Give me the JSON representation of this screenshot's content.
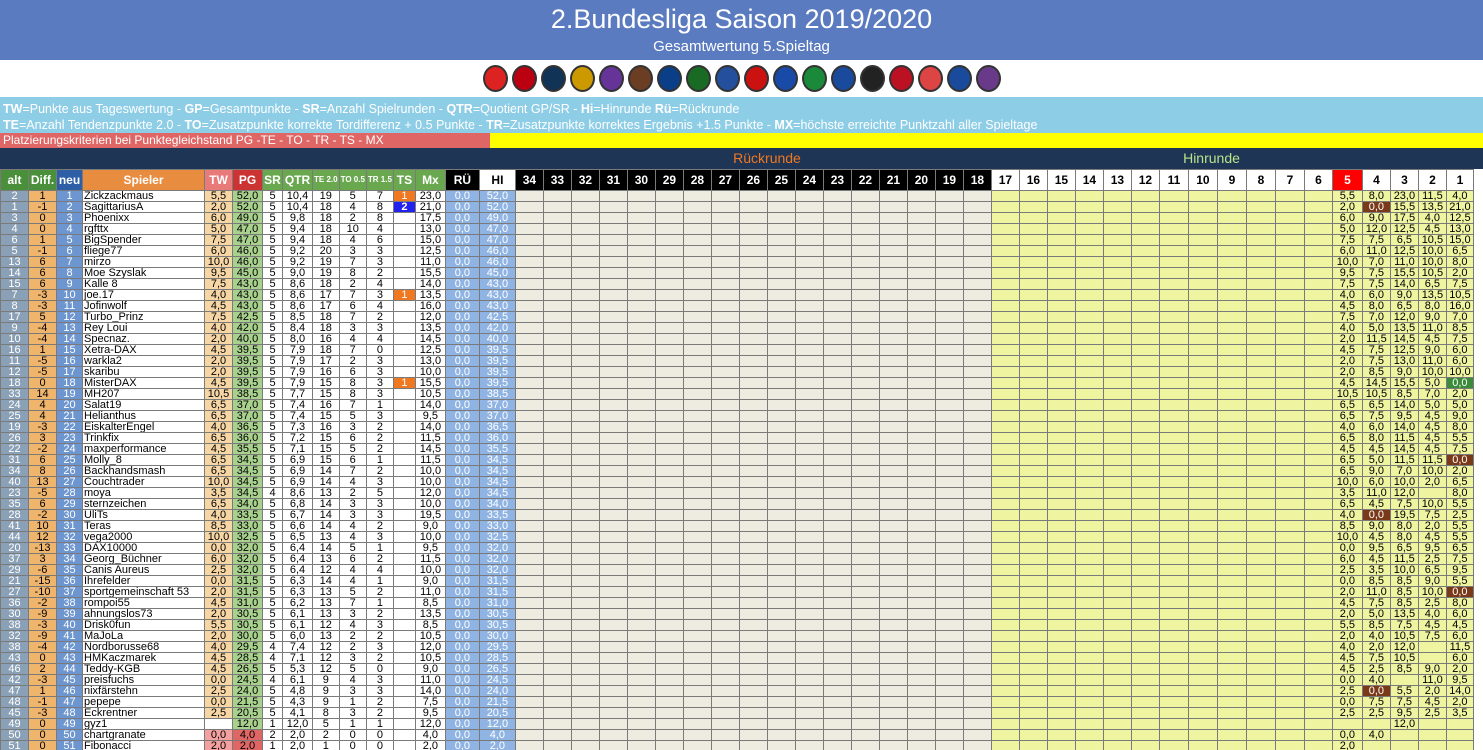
{
  "header": {
    "title": "2.Bundesliga Saison 2019/2020",
    "subtitle": "Gesamtwertung 5.Spieltag"
  },
  "logos": [
    {
      "name": "heidenheim-logo",
      "color": "#d22"
    },
    {
      "name": "nuernberg-logo",
      "color": "#b01"
    },
    {
      "name": "bielefeld-logo",
      "color": "#135"
    },
    {
      "name": "dresden-logo",
      "color": "#c90"
    },
    {
      "name": "aue-logo",
      "color": "#639"
    },
    {
      "name": "stpauli-logo",
      "color": "#6b3d22"
    },
    {
      "name": "hsv-logo",
      "color": "#0a3e87"
    },
    {
      "name": "hannover-logo",
      "color": "#196b24"
    },
    {
      "name": "kiel-logo",
      "color": "#234f9c"
    },
    {
      "name": "regensburg-logo",
      "color": "#c11"
    },
    {
      "name": "karlsruhe-logo",
      "color": "#1a4aa8"
    },
    {
      "name": "fuerth-logo",
      "color": "#1a8a3a"
    },
    {
      "name": "darmstadt-logo",
      "color": "#1a4a9c"
    },
    {
      "name": "sandhausen-logo",
      "color": "#222"
    },
    {
      "name": "wiesbaden-logo",
      "color": "#b12"
    },
    {
      "name": "stuttgart-logo",
      "color": "#d44"
    },
    {
      "name": "bochum-logo",
      "color": "#1a4a9c"
    },
    {
      "name": "osnabrueck-logo",
      "color": "#6a3a8a"
    }
  ],
  "legend": {
    "line1": [
      [
        "TW",
        "=Punkte aus Tageswertung - "
      ],
      [
        "GP",
        "=Gesamtpunkte - "
      ],
      [
        "SR",
        "=Anzahl Spielrunden - "
      ],
      [
        "QTR",
        "=Quotient GP/SR - "
      ],
      [
        "Hi",
        "=Hinrunde "
      ],
      [
        "Rü",
        "=Rückrunde"
      ]
    ],
    "line2": [
      [
        "TE",
        "=Anzahl Tendenzpunkte 2.0 - "
      ],
      [
        "TO",
        "=Zusatzpunkte korrekte Tordifferenz + 0.5 Punkte - "
      ],
      [
        "TR",
        "=Zusatzpunkte korrektes Ergebnis +1.5 Punkte - "
      ],
      [
        "MX",
        "=höchste erreichte Punktzahl aller Spieltage"
      ]
    ]
  },
  "criteria": "Platzierungskriterien bei Punktegleichstand  PG  -TE - TO - TR - TS - MX",
  "groups": {
    "rueckrunde": "Rückrunde",
    "hinrunde": "Hinrunde"
  },
  "columns": {
    "alt": "alt",
    "diff": "Diff.",
    "neu": "neu",
    "spieler": "Spieler",
    "tw": "TW",
    "pg": "PG",
    "sr": "SR",
    "qtr": "QTR",
    "te": "TE 2.0",
    "to": "TO 0.5",
    "tr": "TR 1.5",
    "ts": "TS",
    "mx": "Mx",
    "ru": "RÜ",
    "hi": "HI"
  },
  "rueck_days": [
    "34",
    "33",
    "32",
    "31",
    "30",
    "29",
    "28",
    "27",
    "26",
    "25",
    "24",
    "23",
    "22",
    "21",
    "20",
    "19",
    "18"
  ],
  "hin_days": [
    "17",
    "16",
    "15",
    "14",
    "13",
    "12",
    "11",
    "10",
    "9",
    "8",
    "7",
    "6",
    "5",
    "4",
    "3",
    "2",
    "1"
  ],
  "rows": [
    [
      "2",
      "1",
      "1",
      "Zickzackmaus",
      "5,5",
      "52,0",
      "5",
      "10,4",
      "19",
      "5",
      "7",
      "1",
      "23,0",
      "0,0",
      "52,0",
      "5,5",
      "8,0",
      "23,0",
      "11,5",
      "4,0"
    ],
    [
      "1",
      "-1",
      "2",
      "SagittariusA",
      "2,0",
      "52,0",
      "5",
      "10,4",
      "18",
      "4",
      "8",
      "2",
      "21,0",
      "0,0",
      "52,0",
      "2,0",
      "0,0",
      "15,5",
      "13,5",
      "21,0"
    ],
    [
      "3",
      "0",
      "3",
      "Phoenixx",
      "6,0",
      "49,0",
      "5",
      "9,8",
      "18",
      "2",
      "8",
      "",
      "17,5",
      "0,0",
      "49,0",
      "6,0",
      "9,0",
      "17,5",
      "4,0",
      "12,5"
    ],
    [
      "4",
      "0",
      "4",
      "rgfttx",
      "5,0",
      "47,0",
      "5",
      "9,4",
      "18",
      "10",
      "4",
      "",
      "13,0",
      "0,0",
      "47,0",
      "5,0",
      "12,0",
      "12,5",
      "4,5",
      "13,0"
    ],
    [
      "6",
      "1",
      "5",
      "BigSpender",
      "7,5",
      "47,0",
      "5",
      "9,4",
      "18",
      "4",
      "6",
      "",
      "15,0",
      "0,0",
      "47,0",
      "7,5",
      "7,5",
      "6,5",
      "10,5",
      "15,0"
    ],
    [
      "5",
      "-1",
      "6",
      "fliege77",
      "6,0",
      "46,0",
      "5",
      "9,2",
      "20",
      "3",
      "3",
      "",
      "12,5",
      "0,0",
      "46,0",
      "6,0",
      "11,0",
      "12,5",
      "10,0",
      "6,5"
    ],
    [
      "13",
      "6",
      "7",
      "mirzo",
      "10,0",
      "46,0",
      "5",
      "9,2",
      "19",
      "7",
      "3",
      "",
      "11,0",
      "0,0",
      "46,0",
      "10,0",
      "7,0",
      "11,0",
      "10,0",
      "8,0"
    ],
    [
      "14",
      "6",
      "8",
      "Moe Szyslak",
      "9,5",
      "45,0",
      "5",
      "9,0",
      "19",
      "8",
      "2",
      "",
      "15,5",
      "0,0",
      "45,0",
      "9,5",
      "7,5",
      "15,5",
      "10,5",
      "2,0"
    ],
    [
      "15",
      "6",
      "9",
      "Kalle 8",
      "7,5",
      "43,0",
      "5",
      "8,6",
      "18",
      "2",
      "4",
      "",
      "14,0",
      "0,0",
      "43,0",
      "7,5",
      "7,5",
      "14,0",
      "6,5",
      "7,5"
    ],
    [
      "7",
      "-3",
      "10",
      "joe.17",
      "4,0",
      "43,0",
      "5",
      "8,6",
      "17",
      "7",
      "3",
      "1",
      "13,5",
      "0,0",
      "43,0",
      "4,0",
      "6,0",
      "9,0",
      "13,5",
      "10,5"
    ],
    [
      "8",
      "-3",
      "11",
      "Jofinwolf",
      "4,5",
      "43,0",
      "5",
      "8,6",
      "17",
      "6",
      "4",
      "",
      "16,0",
      "0,0",
      "43,0",
      "4,5",
      "8,0",
      "6,5",
      "8,0",
      "16,0"
    ],
    [
      "17",
      "5",
      "12",
      "Turbo_Prinz",
      "7,5",
      "42,5",
      "5",
      "8,5",
      "18",
      "7",
      "2",
      "",
      "12,0",
      "0,0",
      "42,5",
      "7,5",
      "7,0",
      "12,0",
      "9,0",
      "7,0"
    ],
    [
      "9",
      "-4",
      "13",
      "Rey Loui",
      "4,0",
      "42,0",
      "5",
      "8,4",
      "18",
      "3",
      "3",
      "",
      "13,5",
      "0,0",
      "42,0",
      "4,0",
      "5,0",
      "13,5",
      "11,0",
      "8,5"
    ],
    [
      "10",
      "-4",
      "14",
      "Specnaz.",
      "2,0",
      "40,0",
      "5",
      "8,0",
      "16",
      "4",
      "4",
      "",
      "14,5",
      "0,0",
      "40,0",
      "2,0",
      "11,5",
      "14,5",
      "4,5",
      "7,5"
    ],
    [
      "16",
      "1",
      "15",
      "Xetra-DAX",
      "4,5",
      "39,5",
      "5",
      "7,9",
      "18",
      "7",
      "0",
      "",
      "12,5",
      "0,0",
      "39,5",
      "4,5",
      "7,5",
      "12,5",
      "9,0",
      "6,0"
    ],
    [
      "11",
      "-5",
      "16",
      "warkla2",
      "2,0",
      "39,5",
      "5",
      "7,9",
      "17",
      "2",
      "3",
      "",
      "13,0",
      "0,0",
      "39,5",
      "2,0",
      "7,5",
      "13,0",
      "11,0",
      "6,0"
    ],
    [
      "12",
      "-5",
      "17",
      "skaribu",
      "2,0",
      "39,5",
      "5",
      "7,9",
      "16",
      "6",
      "3",
      "",
      "10,0",
      "0,0",
      "39,5",
      "2,0",
      "8,5",
      "9,0",
      "10,0",
      "10,0"
    ],
    [
      "18",
      "0",
      "18",
      "MisterDAX",
      "4,5",
      "39,5",
      "5",
      "7,9",
      "15",
      "8",
      "3",
      "1",
      "15,5",
      "0,0",
      "39,5",
      "4,5",
      "14,5",
      "15,5",
      "5,0",
      "0,0"
    ],
    [
      "33",
      "14",
      "19",
      "MH207",
      "10,5",
      "38,5",
      "5",
      "7,7",
      "15",
      "8",
      "3",
      "",
      "10,5",
      "0,0",
      "38,5",
      "10,5",
      "10,5",
      "8,5",
      "7,0",
      "2,0"
    ],
    [
      "24",
      "4",
      "20",
      "Salat19",
      "6,5",
      "37,0",
      "5",
      "7,4",
      "16",
      "7",
      "1",
      "",
      "14,0",
      "0,0",
      "37,0",
      "6,5",
      "6,5",
      "14,0",
      "5,0",
      "5,0"
    ],
    [
      "25",
      "4",
      "21",
      "Helianthus",
      "6,5",
      "37,0",
      "5",
      "7,4",
      "15",
      "5",
      "3",
      "",
      "9,5",
      "0,0",
      "37,0",
      "6,5",
      "7,5",
      "9,5",
      "4,5",
      "9,0"
    ],
    [
      "19",
      "-3",
      "22",
      "EiskalterEngel",
      "4,0",
      "36,5",
      "5",
      "7,3",
      "16",
      "3",
      "2",
      "",
      "14,0",
      "0,0",
      "36,5",
      "4,0",
      "6,0",
      "14,0",
      "4,5",
      "8,0"
    ],
    [
      "26",
      "3",
      "23",
      "Trinkfix",
      "6,5",
      "36,0",
      "5",
      "7,2",
      "15",
      "6",
      "2",
      "",
      "11,5",
      "0,0",
      "36,0",
      "6,5",
      "8,0",
      "11,5",
      "4,5",
      "5,5"
    ],
    [
      "22",
      "-2",
      "24",
      "maxperformance",
      "4,5",
      "35,5",
      "5",
      "7,1",
      "15",
      "5",
      "2",
      "",
      "14,5",
      "0,0",
      "35,5",
      "4,5",
      "4,5",
      "14,5",
      "4,5",
      "7,5"
    ],
    [
      "31",
      "6",
      "25",
      "Molly_8",
      "6,5",
      "34,5",
      "5",
      "6,9",
      "15",
      "6",
      "1",
      "",
      "11,5",
      "0,0",
      "34,5",
      "6,5",
      "5,0",
      "11,5",
      "11,5",
      "0,0"
    ],
    [
      "34",
      "8",
      "26",
      "Backhandsmash",
      "6,5",
      "34,5",
      "5",
      "6,9",
      "14",
      "7",
      "2",
      "",
      "10,0",
      "0,0",
      "34,5",
      "6,5",
      "9,0",
      "7,0",
      "10,0",
      "2,0"
    ],
    [
      "40",
      "13",
      "27",
      "Couchtrader",
      "10,0",
      "34,5",
      "5",
      "6,9",
      "14",
      "4",
      "3",
      "",
      "10,0",
      "0,0",
      "34,5",
      "10,0",
      "6,0",
      "10,0",
      "2,0",
      "6,5"
    ],
    [
      "23",
      "-5",
      "28",
      "moya",
      "3,5",
      "34,5",
      "4",
      "8,6",
      "13",
      "2",
      "5",
      "",
      "12,0",
      "0,0",
      "34,5",
      "3,5",
      "11,0",
      "12,0",
      "",
      "8,0"
    ],
    [
      "35",
      "6",
      "29",
      "sternzeichen",
      "6,5",
      "34,0",
      "5",
      "6,8",
      "14",
      "3",
      "3",
      "",
      "10,0",
      "0,0",
      "34,0",
      "6,5",
      "4,5",
      "7,5",
      "10,0",
      "5,5"
    ],
    [
      "28",
      "-2",
      "30",
      "UliTs",
      "4,0",
      "33,5",
      "5",
      "6,7",
      "14",
      "3",
      "3",
      "",
      "19,5",
      "0,0",
      "33,5",
      "4,0",
      "0,0",
      "19,5",
      "7,5",
      "2,5"
    ],
    [
      "41",
      "10",
      "31",
      "Teras",
      "8,5",
      "33,0",
      "5",
      "6,6",
      "14",
      "4",
      "2",
      "",
      "9,0",
      "0,0",
      "33,0",
      "8,5",
      "9,0",
      "8,0",
      "2,0",
      "5,5"
    ],
    [
      "44",
      "12",
      "32",
      "vega2000",
      "10,0",
      "32,5",
      "5",
      "6,5",
      "13",
      "4",
      "3",
      "",
      "10,0",
      "0,0",
      "32,5",
      "10,0",
      "4,5",
      "8,0",
      "4,5",
      "5,5"
    ],
    [
      "20",
      "-13",
      "33",
      "DAX10000",
      "0,0",
      "32,0",
      "5",
      "6,4",
      "14",
      "5",
      "1",
      "",
      "9,5",
      "0,0",
      "32,0",
      "0,0",
      "9,5",
      "6,5",
      "9,5",
      "6,5"
    ],
    [
      "37",
      "3",
      "34",
      "Georg_Büchner",
      "6,0",
      "32,0",
      "5",
      "6,4",
      "13",
      "6",
      "2",
      "",
      "11,5",
      "0,0",
      "32,0",
      "6,0",
      "4,5",
      "11,5",
      "2,5",
      "7,5"
    ],
    [
      "29",
      "-6",
      "35",
      "Canis Aureus",
      "2,5",
      "32,0",
      "5",
      "6,4",
      "12",
      "4",
      "4",
      "",
      "10,0",
      "0,0",
      "32,0",
      "2,5",
      "3,5",
      "10,0",
      "6,5",
      "9,5"
    ],
    [
      "21",
      "-15",
      "36",
      "Ihrefelder",
      "0,0",
      "31,5",
      "5",
      "6,3",
      "14",
      "4",
      "1",
      "",
      "9,0",
      "0,0",
      "31,5",
      "0,0",
      "8,5",
      "8,5",
      "9,0",
      "5,5"
    ],
    [
      "27",
      "-10",
      "37",
      "sportgemeinschaft 53",
      "2,0",
      "31,5",
      "5",
      "6,3",
      "13",
      "5",
      "2",
      "",
      "11,0",
      "0,0",
      "31,5",
      "2,0",
      "11,0",
      "8,5",
      "10,0",
      "0,0"
    ],
    [
      "36",
      "-2",
      "38",
      "rompoi55",
      "4,5",
      "31,0",
      "5",
      "6,2",
      "13",
      "7",
      "1",
      "",
      "8,5",
      "0,0",
      "31,0",
      "4,5",
      "7,5",
      "8,5",
      "2,5",
      "8,0"
    ],
    [
      "30",
      "-9",
      "39",
      "ahnungslos73",
      "2,0",
      "30,5",
      "5",
      "6,1",
      "13",
      "3",
      "2",
      "",
      "13,5",
      "0,0",
      "30,5",
      "2,0",
      "5,0",
      "13,5",
      "4,0",
      "6,0"
    ],
    [
      "38",
      "-3",
      "40",
      "Drisk0fun",
      "5,5",
      "30,5",
      "5",
      "6,1",
      "12",
      "4",
      "3",
      "",
      "8,5",
      "0,0",
      "30,5",
      "5,5",
      "8,5",
      "7,5",
      "4,5",
      "4,5"
    ],
    [
      "32",
      "-9",
      "41",
      "MaJoLa",
      "2,0",
      "30,0",
      "5",
      "6,0",
      "13",
      "2",
      "2",
      "",
      "10,5",
      "0,0",
      "30,0",
      "2,0",
      "4,0",
      "10,5",
      "7,5",
      "6,0"
    ],
    [
      "38",
      "-4",
      "42",
      "Nordborusse68",
      "4,0",
      "29,5",
      "4",
      "7,4",
      "12",
      "2",
      "3",
      "",
      "12,0",
      "0,0",
      "29,5",
      "4,0",
      "2,0",
      "12,0",
      "",
      "11,5"
    ],
    [
      "43",
      "0",
      "43",
      "HMKaczmarek",
      "4,5",
      "28,5",
      "4",
      "7,1",
      "12",
      "3",
      "2",
      "",
      "10,5",
      "0,0",
      "28,5",
      "4,5",
      "7,5",
      "10,5",
      "",
      "6,0"
    ],
    [
      "46",
      "2",
      "44",
      "Teddy-KGB",
      "4,5",
      "26,5",
      "5",
      "5,3",
      "12",
      "5",
      "0",
      "",
      "9,0",
      "0,0",
      "26,5",
      "4,5",
      "2,5",
      "8,5",
      "9,0",
      "2,0"
    ],
    [
      "42",
      "-3",
      "45",
      "preisfuchs",
      "0,0",
      "24,5",
      "4",
      "6,1",
      "9",
      "4",
      "3",
      "",
      "11,0",
      "0,0",
      "24,5",
      "0,0",
      "4,0",
      "",
      "11,0",
      "9,5"
    ],
    [
      "47",
      "1",
      "46",
      "nixfärstehn",
      "2,5",
      "24,0",
      "5",
      "4,8",
      "9",
      "3",
      "3",
      "",
      "14,0",
      "0,0",
      "24,0",
      "2,5",
      "0,0",
      "5,5",
      "2,0",
      "14,0"
    ],
    [
      "48",
      "-1",
      "47",
      "pepepe",
      "0,0",
      "21,5",
      "5",
      "4,3",
      "9",
      "1",
      "2",
      "",
      "7,5",
      "0,0",
      "21,5",
      "0,0",
      "7,5",
      "7,5",
      "4,5",
      "2,0"
    ],
    [
      "45",
      "-3",
      "48",
      "Eckrentner",
      "2,5",
      "20,5",
      "5",
      "4,1",
      "8",
      "3",
      "2",
      "",
      "9,5",
      "0,0",
      "20,5",
      "2,5",
      "2,5",
      "9,5",
      "2,5",
      "3,5"
    ],
    [
      "49",
      "0",
      "49",
      "gyz1",
      "",
      "12,0",
      "1",
      "12,0",
      "5",
      "1",
      "1",
      "",
      "12,0",
      "0,0",
      "12,0",
      "",
      "",
      "12,0",
      "",
      ""
    ],
    [
      "50",
      "0",
      "50",
      "chartgranate",
      "0,0",
      "4,0",
      "2",
      "2,0",
      "2",
      "0",
      "0",
      "",
      "4,0",
      "0,0",
      "4,0",
      "0,0",
      "4,0",
      "",
      "",
      ""
    ],
    [
      "51",
      "0",
      "51",
      "Fibonacci",
      "2,0",
      "2,0",
      "1",
      "2,0",
      "1",
      "0",
      "0",
      "",
      "2,0",
      "0,0",
      "2,0",
      "2,0",
      "",
      "",
      "",
      ""
    ]
  ]
}
